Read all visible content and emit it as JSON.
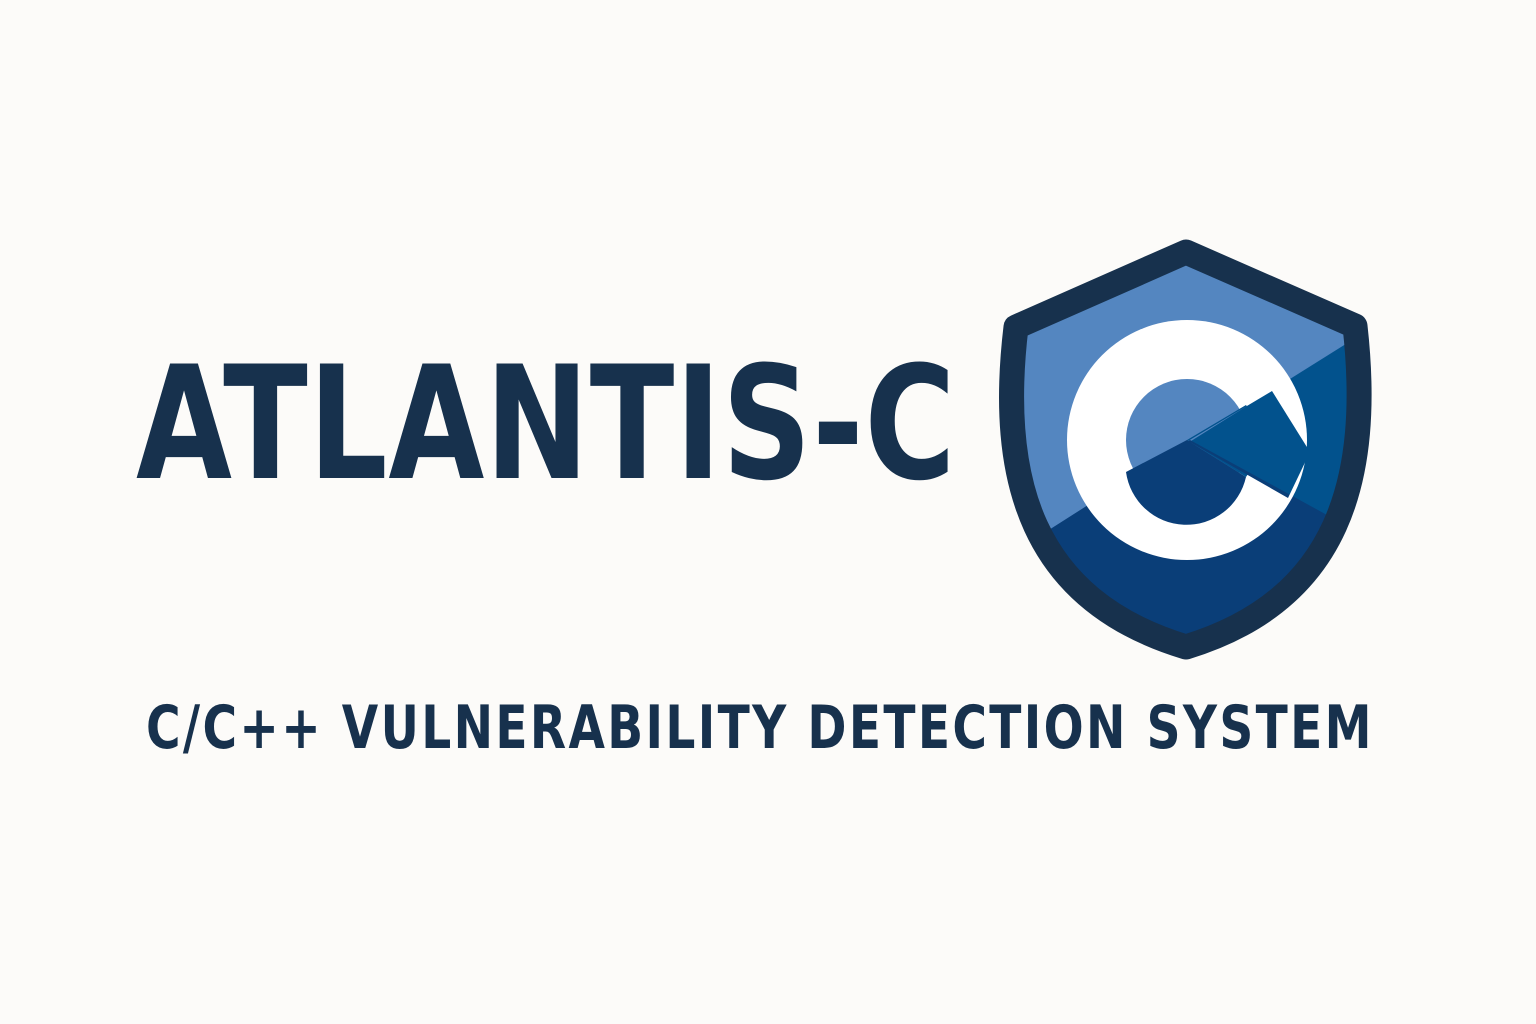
{
  "logo": {
    "title": "ATLANTIS-C",
    "tagline": "C/C++ VULNERABILITY DETECTION SYSTEM",
    "icon": "shield-c-icon",
    "colors": {
      "background": "#fcfbf9",
      "text": "#17314d",
      "shield_outline": "#17314d",
      "shield_light": "#5486c0",
      "shield_mid": "#02528d",
      "shield_dark": "#0a3e78",
      "c_fill": "#ffffff"
    }
  }
}
